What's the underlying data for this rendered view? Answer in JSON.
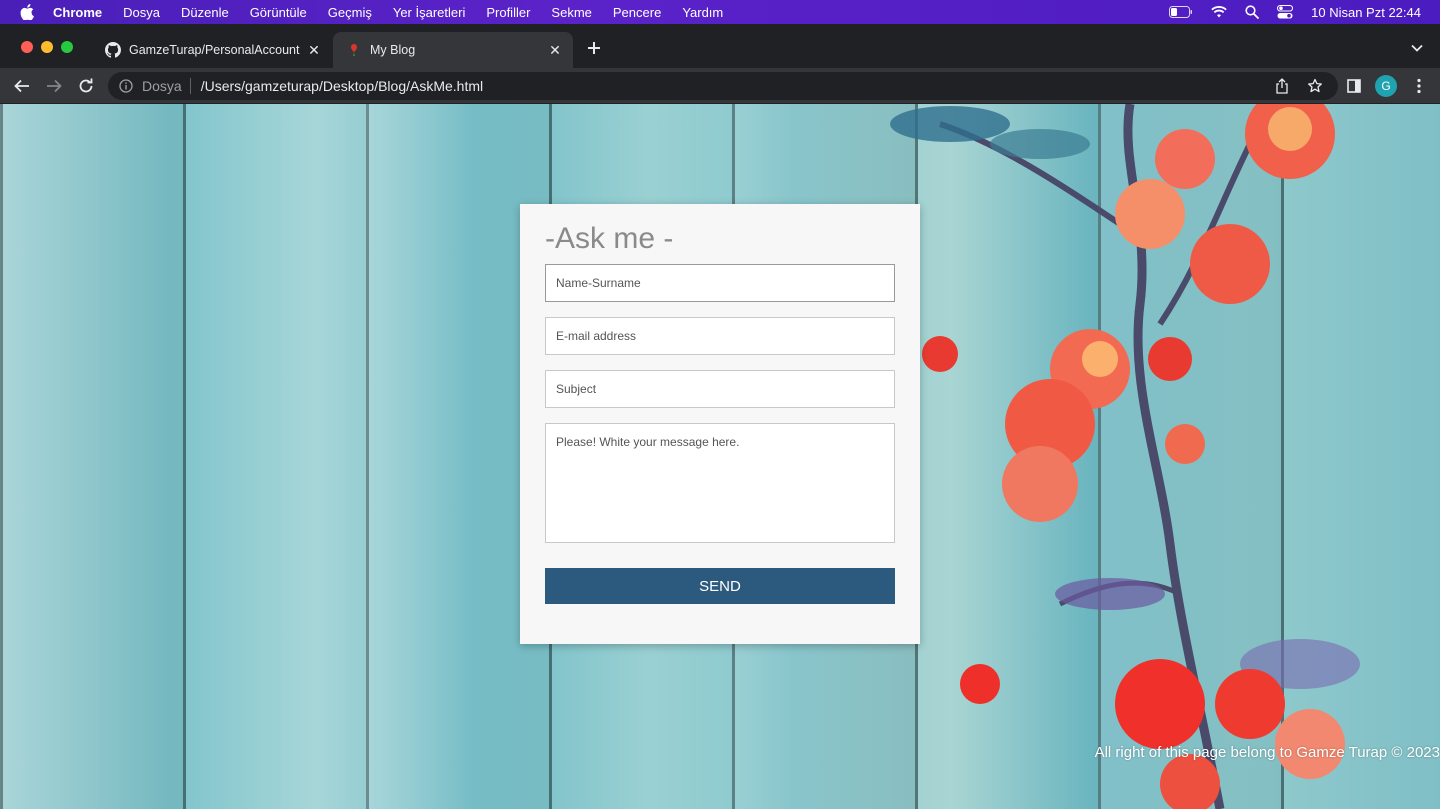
{
  "menubar": {
    "app_name": "Chrome",
    "items": [
      "Dosya",
      "Düzenle",
      "Görüntüle",
      "Geçmiş",
      "Yer İşaretleri",
      "Profiller",
      "Sekme",
      "Pencere",
      "Yardım"
    ],
    "clock": "10 Nisan Pzt  22:44",
    "status_icons": [
      "battery-icon",
      "wifi-icon",
      "search-icon",
      "control-center-icon"
    ]
  },
  "tabs": [
    {
      "title": "GamzeTurap/PersonalAccount",
      "favicon": "github-icon",
      "active": false
    },
    {
      "title": "My Blog",
      "favicon": "blog-favicon-icon",
      "active": true
    }
  ],
  "toolbar": {
    "scheme_label": "Dosya",
    "url": "/Users/gamzeturap/Desktop/Blog/AskMe.html",
    "profile_initial": "G"
  },
  "form": {
    "title": "-Ask me -",
    "name_placeholder": "Name-Surname",
    "email_placeholder": "E-mail address",
    "subject_placeholder": "Subject",
    "message_placeholder": "Please! White your message here.",
    "send_label": "SEND"
  },
  "footer": "All right of this page belong to Gamze Turap © 2023",
  "colors": {
    "menubar": "#5b22c9",
    "card_background": "#f7f7f7",
    "send_button": "#2c5a7e",
    "title_text": "#8a8a8a"
  }
}
